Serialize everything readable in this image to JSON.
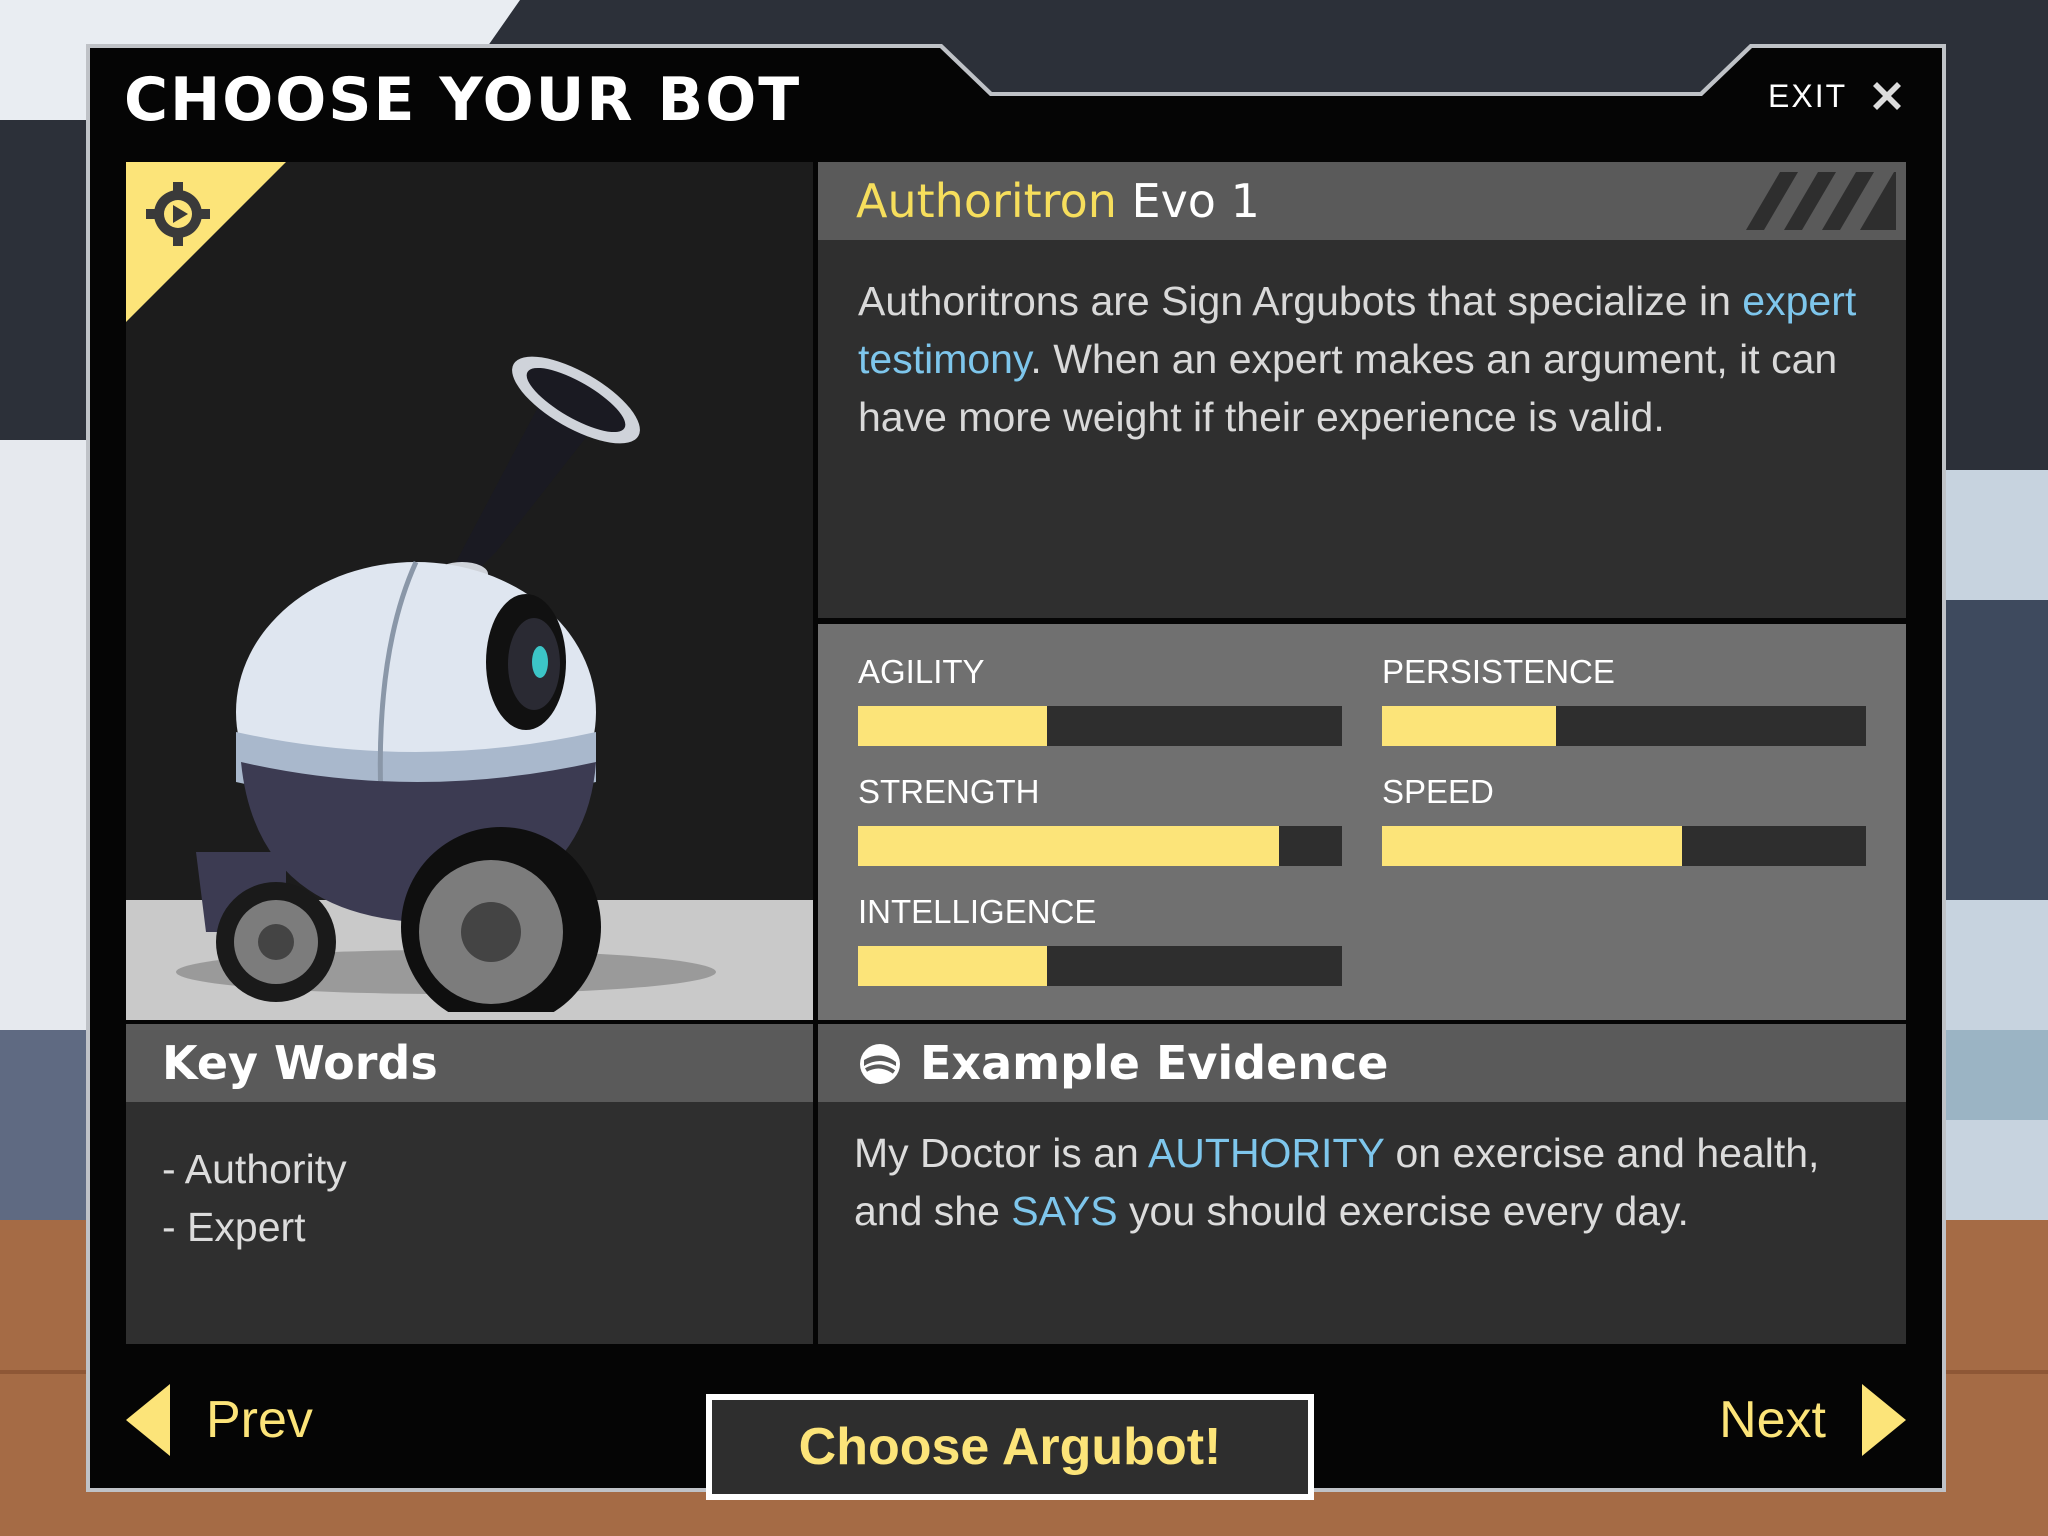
{
  "header": {
    "title": "CHOOSE YOUR BOT",
    "exit_label": "EXIT",
    "exit_icon": "close-icon"
  },
  "bot": {
    "name_main": "Authoritron",
    "name_sub": "Evo 1",
    "portrait_badge_icon": "gear-play-icon",
    "description": {
      "part1": "Authoritrons are Sign Argubots that specialize in ",
      "highlight": "expert testimony",
      "part2": ". When an expert makes an argument, it can have more weight if their experience is valid."
    }
  },
  "stats": [
    {
      "label": "AGILITY",
      "value": 0.39
    },
    {
      "label": "PERSISTENCE",
      "value": 0.36
    },
    {
      "label": "STRENGTH",
      "value": 0.87
    },
    {
      "label": "SPEED",
      "value": 0.62
    },
    {
      "label": "INTELLIGENCE",
      "value": 0.39
    }
  ],
  "keywords": {
    "title": "Key Words",
    "items": [
      "- Authority",
      "- Expert"
    ]
  },
  "evidence": {
    "title": "Example Evidence",
    "icon": "swirl-icon",
    "segments": [
      {
        "text": "My Doctor is an ",
        "highlight": false
      },
      {
        "text": "AUTHORITY",
        "highlight": true
      },
      {
        "text": " on exercise and health, and she ",
        "highlight": false
      },
      {
        "text": "SAYS",
        "highlight": true
      },
      {
        "text": " you should exercise every day.",
        "highlight": false
      }
    ]
  },
  "nav": {
    "prev_label": "Prev",
    "next_label": "Next",
    "choose_label": "Choose Argubot!"
  },
  "colors": {
    "accent": "#fce479",
    "highlight": "#7ec6ec",
    "panel": "#2f2f2f",
    "header": "#5a5a5a"
  }
}
